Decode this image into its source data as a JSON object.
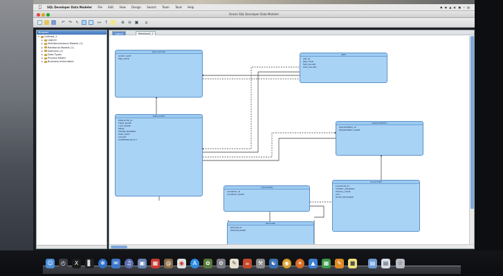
{
  "menubar": {
    "apple": "",
    "app_name": "SQL Developer Data Modeler",
    "menus": [
      "File",
      "Edit",
      "View",
      "Design",
      "Search",
      "Team",
      "Tools",
      "Help"
    ],
    "status_right": "◆ ◉ ▲ ◐ ▣ ⌁ ▤"
  },
  "window": {
    "title": "Oracle SQL Developer Data Modeler"
  },
  "toolbar": {
    "icons": [
      "new-icon",
      "open-icon",
      "save-icon",
      "undo-icon",
      "redo-icon",
      "select-icon",
      "new-entity-icon",
      "new-view-icon",
      "relation-icon",
      "inheritance-icon",
      "note-icon",
      "zoom-in-icon",
      "zoom-out-icon",
      "fit-icon",
      "home-icon"
    ]
  },
  "browser": {
    "title": "Browser",
    "items": [
      {
        "label": "Untitled_1",
        "level": 0
      },
      {
        "label": "Logical",
        "level": 1
      },
      {
        "label": "Multidimensional Models (1)",
        "level": 1
      },
      {
        "label": "Relational Models (1)",
        "level": 1
      },
      {
        "label": "Domains (1)",
        "level": 1
      },
      {
        "label": "Data Types",
        "level": 1
      },
      {
        "label": "Process Model",
        "level": 1
      },
      {
        "label": "Business Information",
        "level": 1
      }
    ]
  },
  "tabs": [
    {
      "label": "Logical",
      "active": true
    },
    {
      "label": "Relational_1",
      "active": false
    }
  ],
  "entities": [
    {
      "id": "e1",
      "name": "JOB_HISTORY",
      "attrs": [
        "START_DATE",
        "END_DATE"
      ]
    },
    {
      "id": "e2",
      "name": "JOBS",
      "attrs": [
        "JOB_ID",
        "JOB_TITLE",
        "MIN_SALARY",
        "MAX_SALARY"
      ]
    },
    {
      "id": "e3",
      "name": "EMPLOYEES",
      "attrs": [
        "EMPLOYEE_ID",
        "FIRST_NAME",
        "LAST_NAME",
        "EMAIL",
        "PHONE_NUMBER",
        "HIRE_DATE",
        "SALARY",
        "COMMISSION_PCT"
      ]
    },
    {
      "id": "e4",
      "name": "DEPARTMENTS",
      "attrs": [
        "DEPARTMENT_ID",
        "DEPARTMENT_NAME"
      ]
    },
    {
      "id": "e5",
      "name": "LOCATIONS",
      "attrs": [
        "LOCATION_ID",
        "STREET_ADDRESS",
        "POSTAL_CODE",
        "CITY",
        "STATE_PROVINCE"
      ]
    },
    {
      "id": "e6",
      "name": "COUNTRIES",
      "attrs": [
        "COUNTRY_ID",
        "COUNTRY_NAME"
      ]
    },
    {
      "id": "e7",
      "name": "REGIONS",
      "attrs": [
        "REGION_ID",
        "REGION_NAME"
      ]
    }
  ],
  "dock": {
    "icons": [
      "finder-icon",
      "dashboard-icon",
      "x11-icon",
      "terminal-icon",
      "safari-icon",
      "mail-icon",
      "itunes-icon",
      "preview-icon",
      "calendar-icon",
      "address-book-icon",
      "ical-icon",
      "app-store-icon",
      "photo-icon",
      "system-prefs-icon",
      "textedit-icon",
      "java-icon",
      "utility-icon",
      "web-icon",
      "chrome-icon",
      "firefox-icon",
      "keynote-icon",
      "numbers-icon",
      "pages-icon",
      "stickies-icon",
      "folder-icon",
      "documents-icon",
      "trash-icon"
    ]
  }
}
